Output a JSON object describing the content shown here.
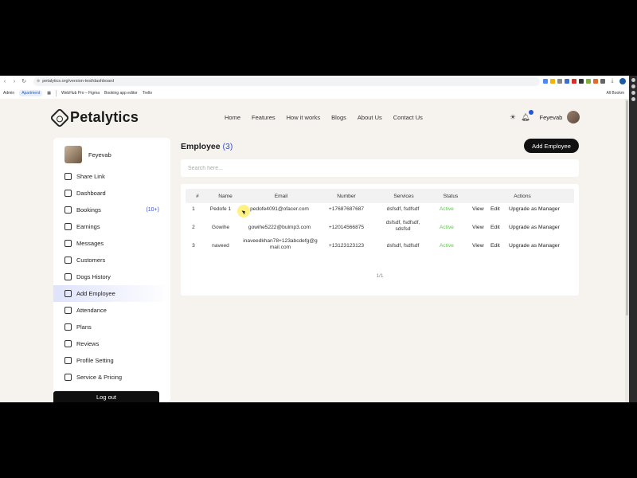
{
  "browser": {
    "url": "petalytics.org/version-test/dashboard",
    "bookmarks": [
      "Admin",
      "Apartment",
      "WebHub Pro – Figma",
      "Booking app editor",
      "Trello"
    ],
    "all_bookmarks_label": "All Bookm"
  },
  "header": {
    "brand": "Petalytics",
    "nav": [
      "Home",
      "Features",
      "How it works",
      "Blogs",
      "About Us",
      "Contact Us"
    ],
    "username": "Feyevab"
  },
  "sidebar": {
    "username": "Feyevab",
    "items": [
      {
        "label": "Share Link",
        "icon": "share-icon"
      },
      {
        "label": "Dashboard",
        "icon": "dashboard-icon"
      },
      {
        "label": "Bookings",
        "icon": "calendar-icon",
        "count": "(10+)"
      },
      {
        "label": "Earnings",
        "icon": "earnings-icon"
      },
      {
        "label": "Messages",
        "icon": "message-icon"
      },
      {
        "label": "Customers",
        "icon": "users-icon"
      },
      {
        "label": "Dogs History",
        "icon": "dog-icon"
      },
      {
        "label": "Add Employee",
        "icon": "add-user-icon",
        "active": true
      },
      {
        "label": "Attendance",
        "icon": "attendance-icon"
      },
      {
        "label": "Plans",
        "icon": "plans-icon"
      },
      {
        "label": "Reviews",
        "icon": "reviews-icon"
      },
      {
        "label": "Profile Setting",
        "icon": "settings-icon"
      },
      {
        "label": "Service & Pricing",
        "icon": "pricing-icon"
      }
    ],
    "logout_label": "Log out"
  },
  "main": {
    "title": "Employee",
    "count": "(3)",
    "add_button": "Add Employee",
    "search_placeholder": "Search here...",
    "columns": [
      "#",
      "Name",
      "Email",
      "Number",
      "Services",
      "Status",
      "Actions"
    ],
    "rows": [
      {
        "num": "1",
        "name": "Pedofe 1",
        "email": "pedofe4091@ofacer.com",
        "number": "+17687687687",
        "services": "dsfsdf, fsdfsdf",
        "status": "Active"
      },
      {
        "num": "2",
        "name": "Gowihe",
        "email": "gowihe5222@bulmp3.com",
        "number": "+12014566875",
        "services": "dsfsdf, fsdfsdf, sdsfsd",
        "status": "Active"
      },
      {
        "num": "3",
        "name": "naveed",
        "email": "inaveedkhan78+123abcdefg@gmail.com",
        "number": "+13123123123",
        "services": "dsfsdf, fsdfsdf",
        "status": "Active"
      }
    ],
    "actions": {
      "view": "View",
      "edit": "Edit",
      "upgrade": "Upgrade as Manager"
    },
    "pagination": "1/1"
  }
}
